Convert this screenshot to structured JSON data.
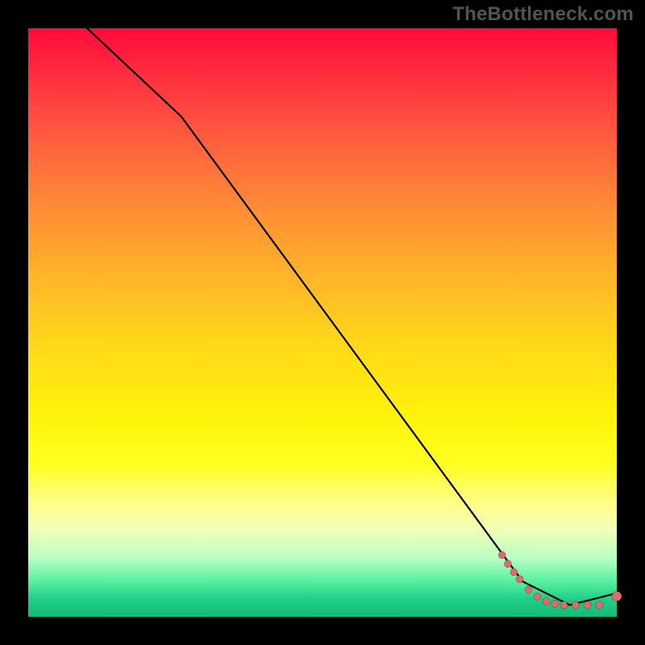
{
  "watermark": "TheBottleneck.com",
  "chart_data": {
    "type": "line",
    "title": "",
    "xlabel": "",
    "ylabel": "",
    "xlim": [
      0,
      100
    ],
    "ylim": [
      0,
      100
    ],
    "grid": false,
    "series": [
      {
        "name": "curve",
        "style": "line",
        "color": "#000000",
        "x": [
          10,
          26,
          84,
          92,
          100
        ],
        "y": [
          100,
          85,
          6,
          2,
          4
        ]
      },
      {
        "name": "points",
        "style": "scatter",
        "color": "#e46a6a",
        "x": [
          80.5,
          81.5,
          82.5,
          83.5,
          85.0,
          86.5,
          88.0,
          89.5,
          91.0,
          93.0,
          95.0,
          97.0,
          100.0
        ],
        "y": [
          10.5,
          9.0,
          7.6,
          6.4,
          4.6,
          3.4,
          2.6,
          2.2,
          2.0,
          2.0,
          2.0,
          2.0,
          3.5
        ]
      }
    ]
  },
  "colors": {
    "dot": "#e46a6a",
    "line": "#000000",
    "watermark": "#535353"
  }
}
